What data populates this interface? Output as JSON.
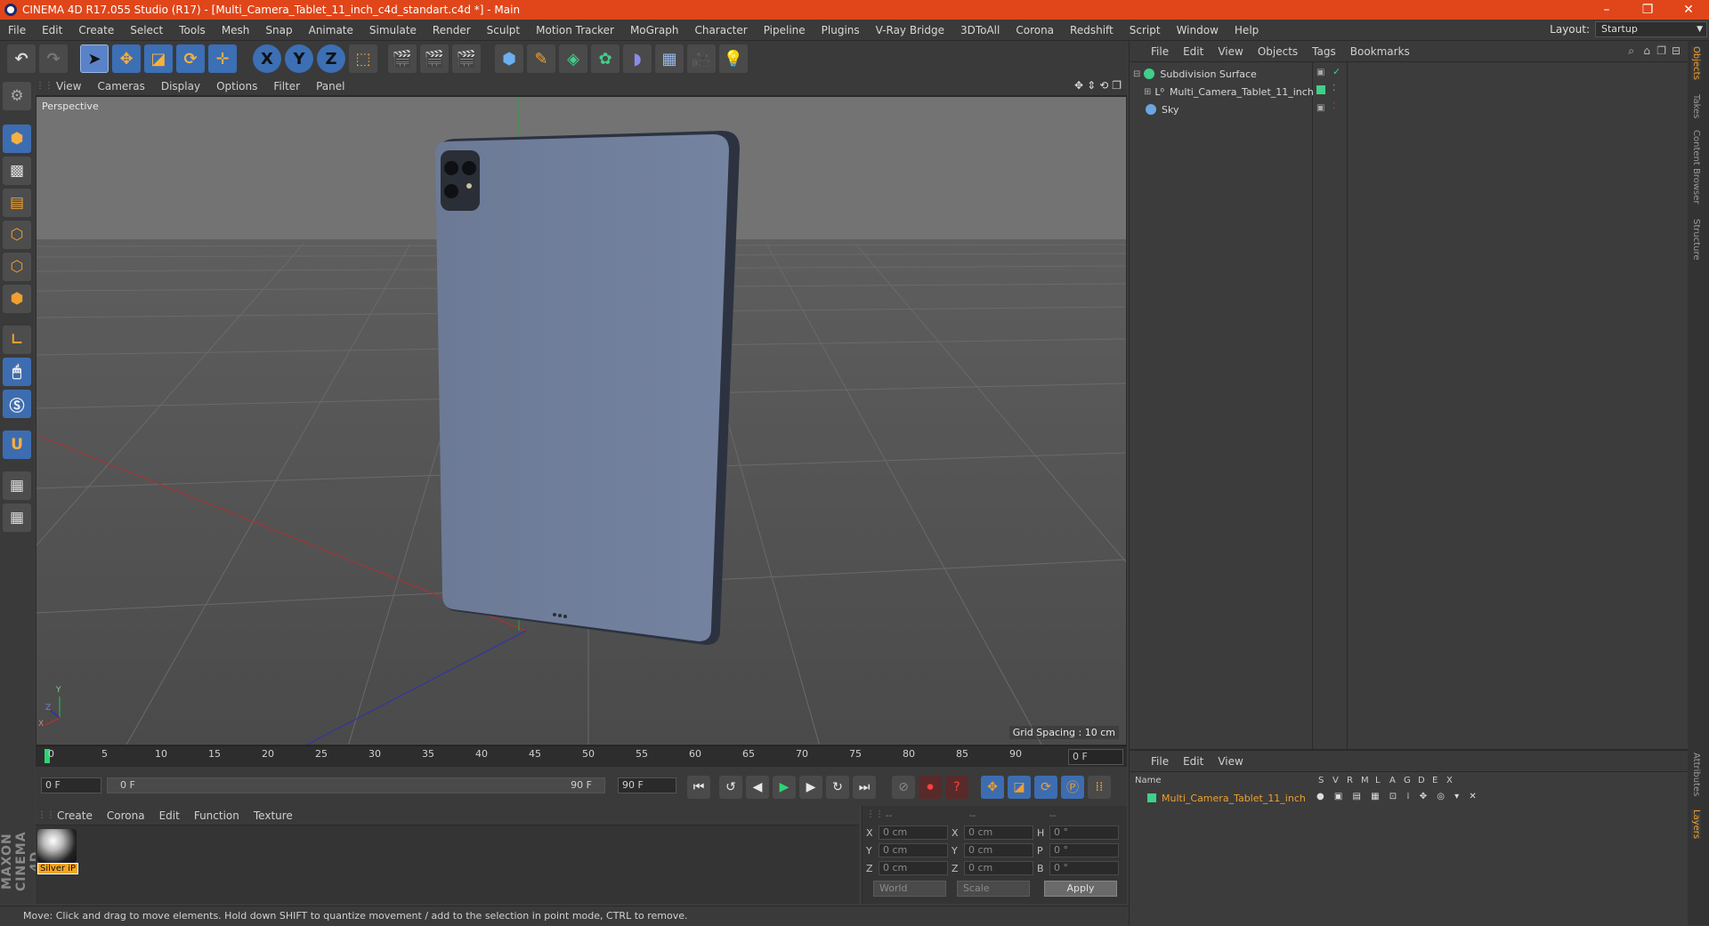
{
  "window": {
    "title": "CINEMA 4D R17.055 Studio (R17) - [Multi_Camera_Tablet_11_inch_c4d_standart.c4d *] - Main",
    "controls": [
      "–",
      "❐",
      "✕"
    ]
  },
  "menubar": {
    "items": [
      "File",
      "Edit",
      "Create",
      "Select",
      "Tools",
      "Mesh",
      "Snap",
      "Animate",
      "Simulate",
      "Render",
      "Sculpt",
      "Motion Tracker",
      "MoGraph",
      "Character",
      "Pipeline",
      "Plugins",
      "V-Ray Bridge",
      "3DToAll",
      "Corona",
      "Redshift",
      "Script",
      "Window",
      "Help"
    ],
    "layout_label": "Layout:",
    "layout_value": "Startup"
  },
  "toolbar": {
    "axis_x": "X",
    "axis_y": "Y",
    "axis_z": "Z"
  },
  "viewport": {
    "menu": [
      "View",
      "Cameras",
      "Display",
      "Options",
      "Filter",
      "Panel"
    ],
    "label": "Perspective",
    "grid_spacing": "Grid Spacing : 10 cm",
    "axis_y": "Y",
    "axis_x": "X",
    "axis_z": "Z"
  },
  "timeline": {
    "ticks": [
      "0",
      "5",
      "10",
      "15",
      "20",
      "25",
      "30",
      "35",
      "40",
      "45",
      "50",
      "55",
      "60",
      "65",
      "70",
      "75",
      "80",
      "85",
      "90"
    ],
    "current_frame": "0 F"
  },
  "transport": {
    "start_frame": "0 F",
    "range_start": "0 F",
    "range_end": "90 F",
    "end_frame": "90 F"
  },
  "materials": {
    "menu": [
      "Create",
      "Corona",
      "Edit",
      "Function",
      "Texture"
    ],
    "items": [
      {
        "name": "Silver iP"
      }
    ]
  },
  "coordinates": {
    "headers": [
      "--",
      "--",
      "--"
    ],
    "rows": [
      {
        "l1": "X",
        "v1": "0 cm",
        "l2": "X",
        "v2": "0 cm",
        "l3": "H",
        "v3": "0 °"
      },
      {
        "l1": "Y",
        "v1": "0 cm",
        "l2": "Y",
        "v2": "0 cm",
        "l3": "P",
        "v3": "0 °"
      },
      {
        "l1": "Z",
        "v1": "0 cm",
        "l2": "Z",
        "v2": "0 cm",
        "l3": "B",
        "v3": "0 °"
      }
    ],
    "world": "World",
    "scale": "Scale",
    "apply": "Apply"
  },
  "status": "Move: Click and drag to move elements. Hold down SHIFT to quantize movement / add to the selection in point mode, CTRL to remove.",
  "objects": {
    "menu": [
      "File",
      "Edit",
      "View",
      "Objects",
      "Tags",
      "Bookmarks"
    ],
    "items": [
      {
        "name": "Subdivision Surface",
        "indent": 0,
        "color": "#3fd08a"
      },
      {
        "name": "Multi_Camera_Tablet_11_inch",
        "indent": 1,
        "color": "#888888"
      },
      {
        "name": "Sky",
        "indent": 0,
        "color": "#6aa6e0"
      }
    ]
  },
  "layers": {
    "menu": [
      "File",
      "Edit",
      "View"
    ],
    "col_name": "Name",
    "cols": [
      "S",
      "V",
      "R",
      "M",
      "L",
      "A",
      "G",
      "D",
      "E",
      "X"
    ],
    "item": "Multi_Camera_Tablet_11_inch",
    "item_color": "#3fd08a"
  },
  "side_tabs": [
    "Objects",
    "Takes",
    "Content Browser",
    "Structure",
    "Attributes",
    "Layers"
  ],
  "brand": "MAXON CINEMA 4D"
}
